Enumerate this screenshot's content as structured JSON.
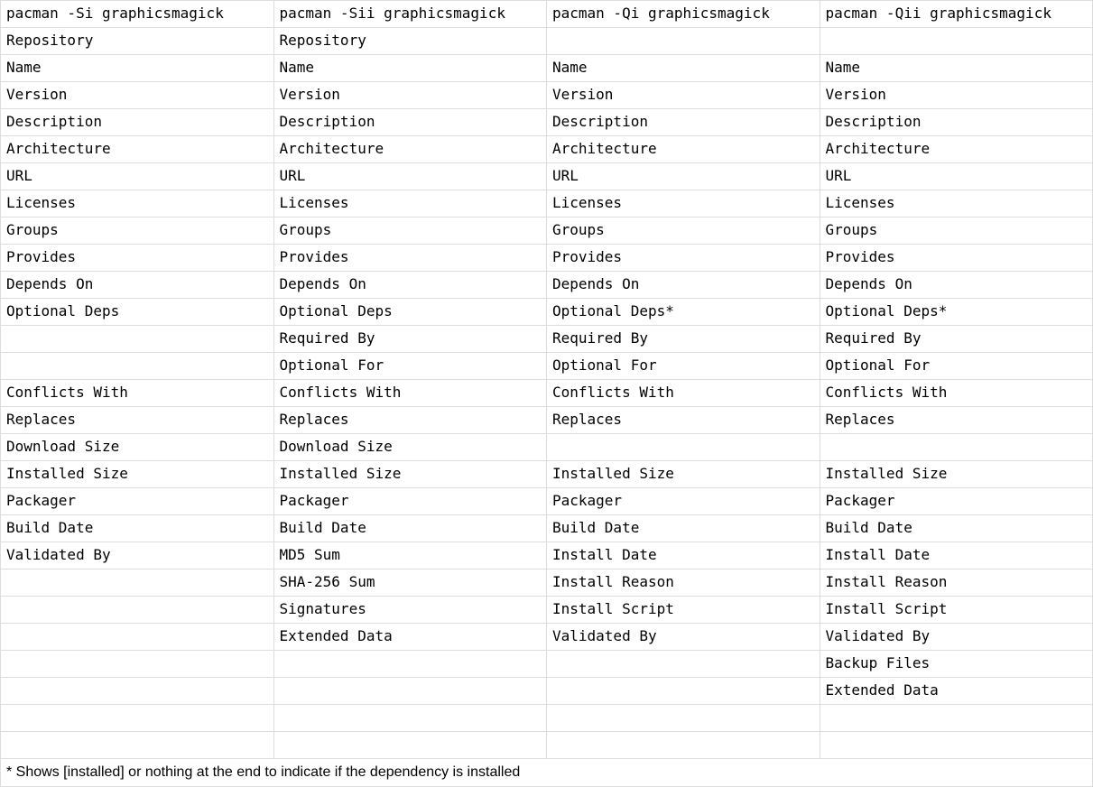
{
  "table": {
    "headers": [
      "pacman -Si graphicsmagick",
      "pacman -Sii graphicsmagick",
      "pacman -Qi graphicsmagick",
      "pacman -Qii graphicsmagick"
    ],
    "rows": [
      [
        "Repository",
        "Repository",
        "",
        ""
      ],
      [
        "Name",
        "Name",
        "Name",
        "Name"
      ],
      [
        "Version",
        "Version",
        "Version",
        "Version"
      ],
      [
        "Description",
        "Description",
        "Description",
        "Description"
      ],
      [
        "Architecture",
        "Architecture",
        "Architecture",
        "Architecture"
      ],
      [
        "URL",
        "URL",
        "URL",
        "URL"
      ],
      [
        "Licenses",
        "Licenses",
        "Licenses",
        "Licenses"
      ],
      [
        "Groups",
        "Groups",
        "Groups",
        "Groups"
      ],
      [
        "Provides",
        "Provides",
        "Provides",
        "Provides"
      ],
      [
        "Depends On",
        "Depends On",
        "Depends On",
        "Depends On"
      ],
      [
        "Optional Deps",
        "Optional Deps",
        "Optional Deps*",
        "Optional Deps*"
      ],
      [
        "",
        "Required By",
        "Required By",
        "Required By"
      ],
      [
        "",
        "Optional For",
        "Optional For",
        "Optional For"
      ],
      [
        "Conflicts With",
        "Conflicts With",
        "Conflicts With",
        "Conflicts With"
      ],
      [
        "Replaces",
        "Replaces",
        "Replaces",
        "Replaces"
      ],
      [
        "Download Size",
        "Download Size",
        "",
        ""
      ],
      [
        "Installed Size",
        "Installed Size",
        "Installed Size",
        "Installed Size"
      ],
      [
        "Packager",
        "Packager",
        "Packager",
        "Packager"
      ],
      [
        "Build Date",
        "Build Date",
        "Build Date",
        "Build Date"
      ],
      [
        "Validated By",
        "MD5 Sum",
        "Install Date",
        "Install Date"
      ],
      [
        "",
        "SHA-256 Sum",
        "Install Reason",
        "Install Reason"
      ],
      [
        "",
        "Signatures",
        "Install Script",
        "Install Script"
      ],
      [
        "",
        "Extended Data",
        "Validated By",
        "Validated By"
      ],
      [
        "",
        "",
        "",
        "Backup Files"
      ],
      [
        "",
        "",
        "",
        "Extended Data"
      ],
      [
        "",
        "",
        "",
        ""
      ],
      [
        "",
        "",
        "",
        ""
      ]
    ],
    "footnote": "* Shows [installed] or nothing at the end to indicate if the dependency is installed"
  }
}
